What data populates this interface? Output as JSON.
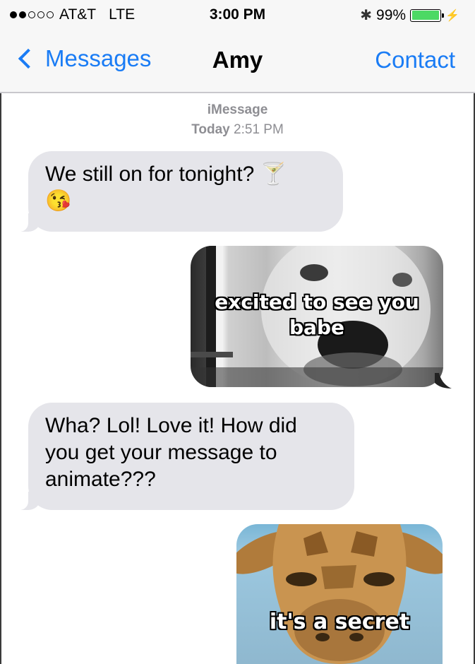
{
  "status_bar": {
    "carrier": "AT&T",
    "network": "LTE",
    "time": "3:00 PM",
    "battery": "99%",
    "battery_level": 0.99,
    "signal_bars_filled": 2,
    "signal_bars_total": 5
  },
  "nav": {
    "back_label": "Messages",
    "title": "Amy",
    "contact_label": "Contact"
  },
  "thread": {
    "service": "iMessage",
    "day": "Today",
    "time": "2:51 PM"
  },
  "messages": [
    {
      "from": "contact",
      "type": "text",
      "text": "We still on for tonight? 🍸",
      "emoji": "😘"
    },
    {
      "from": "me",
      "type": "image",
      "caption_line1": "excited to see you",
      "caption_line2": "babe"
    },
    {
      "from": "contact",
      "type": "text",
      "text": "Wha?  Lol!  Love it!  How did you get your message to animate???"
    },
    {
      "from": "me",
      "type": "image",
      "caption": "it's a secret"
    }
  ],
  "colors": {
    "ios_blue": "#1a7cf5",
    "incoming_bubble": "#e5e5ea",
    "timestamp": "#8e8e93",
    "battery_green": "#4cd964"
  }
}
